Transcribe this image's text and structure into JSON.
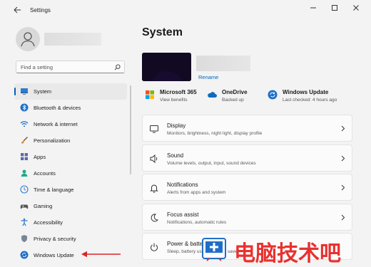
{
  "window": {
    "title": "Settings"
  },
  "sidebar": {
    "search_placeholder": "Find a setting",
    "items": [
      {
        "label": "System",
        "icon": "monitor-icon",
        "selected": true
      },
      {
        "label": "Bluetooth & devices",
        "icon": "bluetooth-icon"
      },
      {
        "label": "Network & internet",
        "icon": "wifi-icon"
      },
      {
        "label": "Personalization",
        "icon": "brush-icon"
      },
      {
        "label": "Apps",
        "icon": "apps-icon"
      },
      {
        "label": "Accounts",
        "icon": "person-icon"
      },
      {
        "label": "Time & language",
        "icon": "globe-clock-icon"
      },
      {
        "label": "Gaming",
        "icon": "gamepad-icon"
      },
      {
        "label": "Accessibility",
        "icon": "accessibility-icon"
      },
      {
        "label": "Privacy & security",
        "icon": "shield-icon"
      },
      {
        "label": "Windows Update",
        "icon": "update-icon"
      }
    ]
  },
  "main": {
    "title": "System",
    "rename_label": "Rename",
    "status": [
      {
        "title": "Microsoft 365",
        "sub": "View benefits",
        "icon": "microsoft-365-icon"
      },
      {
        "title": "OneDrive",
        "sub": "Backed up",
        "icon": "onedrive-cloud-icon"
      },
      {
        "title": "Windows Update",
        "sub": "Last checked: 4 hours ago",
        "icon": "windows-update-icon"
      }
    ],
    "cards": [
      {
        "title": "Display",
        "sub": "Monitors, brightness, night light, display profile",
        "icon": "display-icon"
      },
      {
        "title": "Sound",
        "sub": "Volume levels, output, input, sound devices",
        "icon": "speaker-icon"
      },
      {
        "title": "Notifications",
        "sub": "Alerts from apps and system",
        "icon": "bell-icon"
      },
      {
        "title": "Focus assist",
        "sub": "Notifications, automatic rules",
        "icon": "moon-icon"
      },
      {
        "title": "Power & battery",
        "sub": "Sleep, battery usage, battery saver",
        "icon": "power-icon"
      }
    ]
  },
  "watermark": {
    "text": "电脑技术吧"
  },
  "colors": {
    "accent": "#005fb8",
    "link": "#0067c0",
    "annotation_arrow": "#d9252a",
    "watermark": "#e8312f"
  }
}
